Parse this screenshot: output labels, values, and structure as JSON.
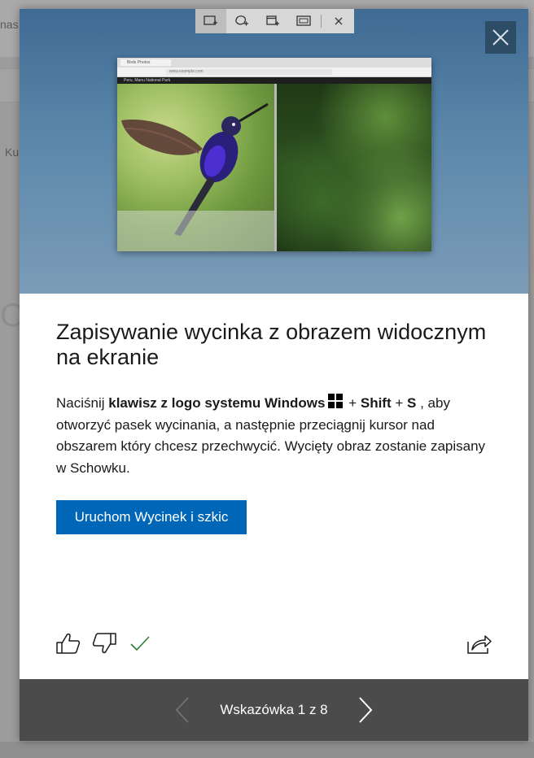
{
  "background": {
    "top_text": "nas",
    "bar_text": "Ku",
    "big_text": "O"
  },
  "snip_toolbar": {
    "icons": [
      "rectangular-snip-icon",
      "freeform-snip-icon",
      "window-snip-icon",
      "fullscreen-snip-icon",
      "close-icon"
    ]
  },
  "hero_mock": {
    "tab_label": "Birds Photos",
    "url": "www.example.com",
    "nav_text": "Peru, Manu National Park"
  },
  "tip": {
    "title": "Zapisywanie wycinka z obrazem widocznym na ekranie",
    "desc_prefix": "Naciśnij ",
    "desc_key_label": "klawisz z logo systemu Windows",
    "desc_plus1": " + ",
    "desc_shift": "Shift",
    "desc_plus2": " + ",
    "desc_s": "S",
    "desc_rest": " , aby otworzyć pasek wycinania, a następnie przeciągnij kursor nad obszarem który chcesz przechwycić. Wycięty obraz zostanie zapisany w Schowku.",
    "button_label": "Uruchom Wycinek i szkic"
  },
  "footer": {
    "counter": "Wskazówka 1 z 8"
  },
  "colors": {
    "accent": "#0067b8",
    "footer_bg": "#4b4b4b",
    "check": "#2f7d32"
  }
}
